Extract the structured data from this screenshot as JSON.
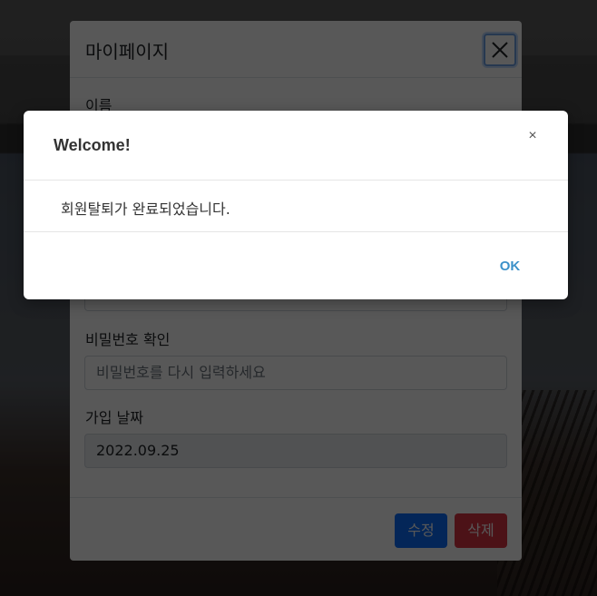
{
  "mypage": {
    "title": "마이페이지",
    "fields": [
      {
        "label": "이름"
      },
      {
        "label": "비밀번호 확인",
        "placeholder": "비밀번호를 다시 입력하세요"
      },
      {
        "label": "가입 날짜",
        "value": "2022.09.25"
      }
    ],
    "edit_label": "수정",
    "delete_label": "삭제"
  },
  "alert": {
    "title": "Welcome!",
    "close_label": "×",
    "message": "회원탈퇴가 완료되었습니다.",
    "ok_label": "OK"
  },
  "colors": {
    "primary": "#0d6efd",
    "danger": "#dc3545",
    "ok_link": "#3c91c9"
  }
}
